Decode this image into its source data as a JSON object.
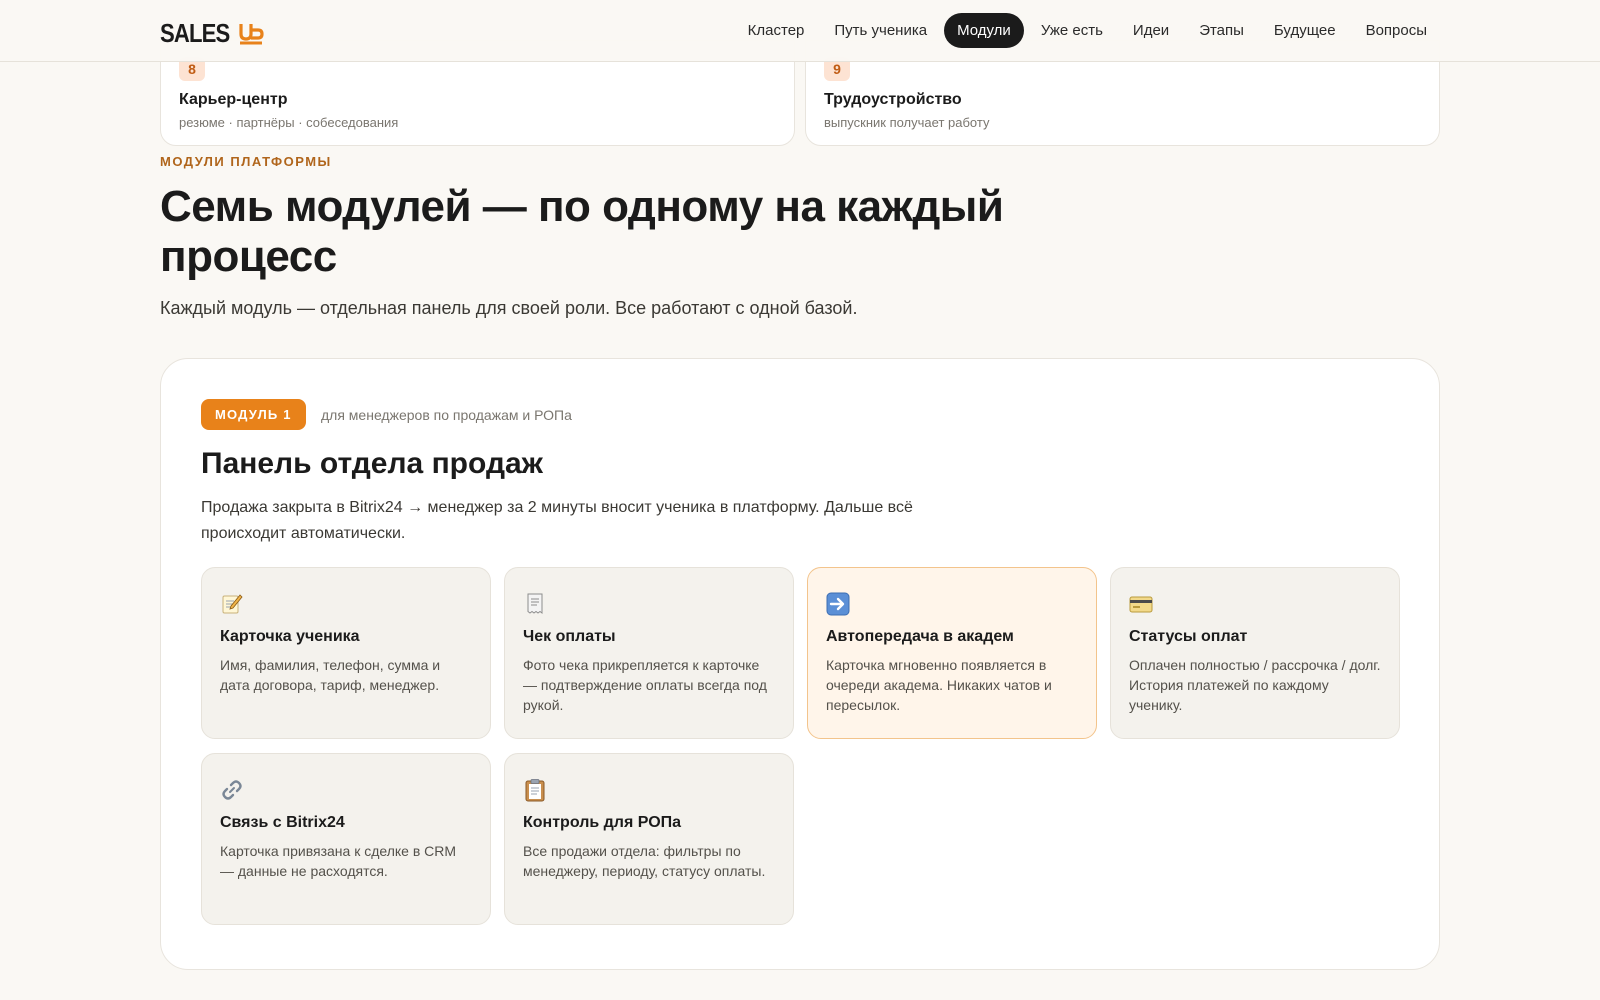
{
  "header": {
    "logo_text": "SALES",
    "nav": [
      "Кластер",
      "Путь ученика",
      "Модули",
      "Уже есть",
      "Идеи",
      "Этапы",
      "Будущее",
      "Вопросы"
    ],
    "active_nav": "Модули"
  },
  "previous_cards": [
    {
      "number": "8",
      "title": "Карьер-центр",
      "subtitle": "резюме · партнёры · собеседования"
    },
    {
      "number": "9",
      "title": "Трудоустройство",
      "subtitle": "выпускник получает работу"
    }
  ],
  "section": {
    "eyebrow": "Модули платформы",
    "title": "Семь модулей — по одному на каждый процесс",
    "lead": "Каждый модуль — отдельная панель для своей роли. Все работают с одной базой."
  },
  "module": {
    "badge": "Модуль 1",
    "audience": "для менеджеров по продажам и РОПа",
    "title": "Панель отдела продаж",
    "description": "Продажа закрыта в Bitrix24 → менеджер за 2 минуты вносит ученика в платформу. Дальше всё происходит автоматически.",
    "features": [
      {
        "icon": "memo-icon",
        "title": "Карточка ученика",
        "text": "Имя, фамилия, телефон, сумма и дата договора, тариф, менеджер."
      },
      {
        "icon": "receipt-icon",
        "title": "Чек оплаты",
        "text": "Фото чека прикрепляется к карточке — подтверждение оплаты всегда под рукой."
      },
      {
        "icon": "arrow-right-icon",
        "title": "Автопередача в академ",
        "text": "Карточка мгновенно появляется в очереди академа. Никаких чатов и пересылок."
      },
      {
        "icon": "credit-card-icon",
        "title": "Статусы оплат",
        "text": "Оплачен полностью / рассрочка / долг. История платежей по каждому ученику."
      },
      {
        "icon": "link-icon",
        "title": "Связь с Bitrix24",
        "text": "Карточка привязана к сделке в CRM — данные не расходятся."
      },
      {
        "icon": "clipboard-icon",
        "title": "Контроль для РОПа",
        "text": "Все продажи отдела: фильтры по менеджеру, периоду, статусу оплаты."
      }
    ]
  },
  "colors": {
    "accent": "#e8821a",
    "eyebrow": "#b0651b",
    "background": "#faf8f4",
    "dark": "#1b1b1b"
  }
}
